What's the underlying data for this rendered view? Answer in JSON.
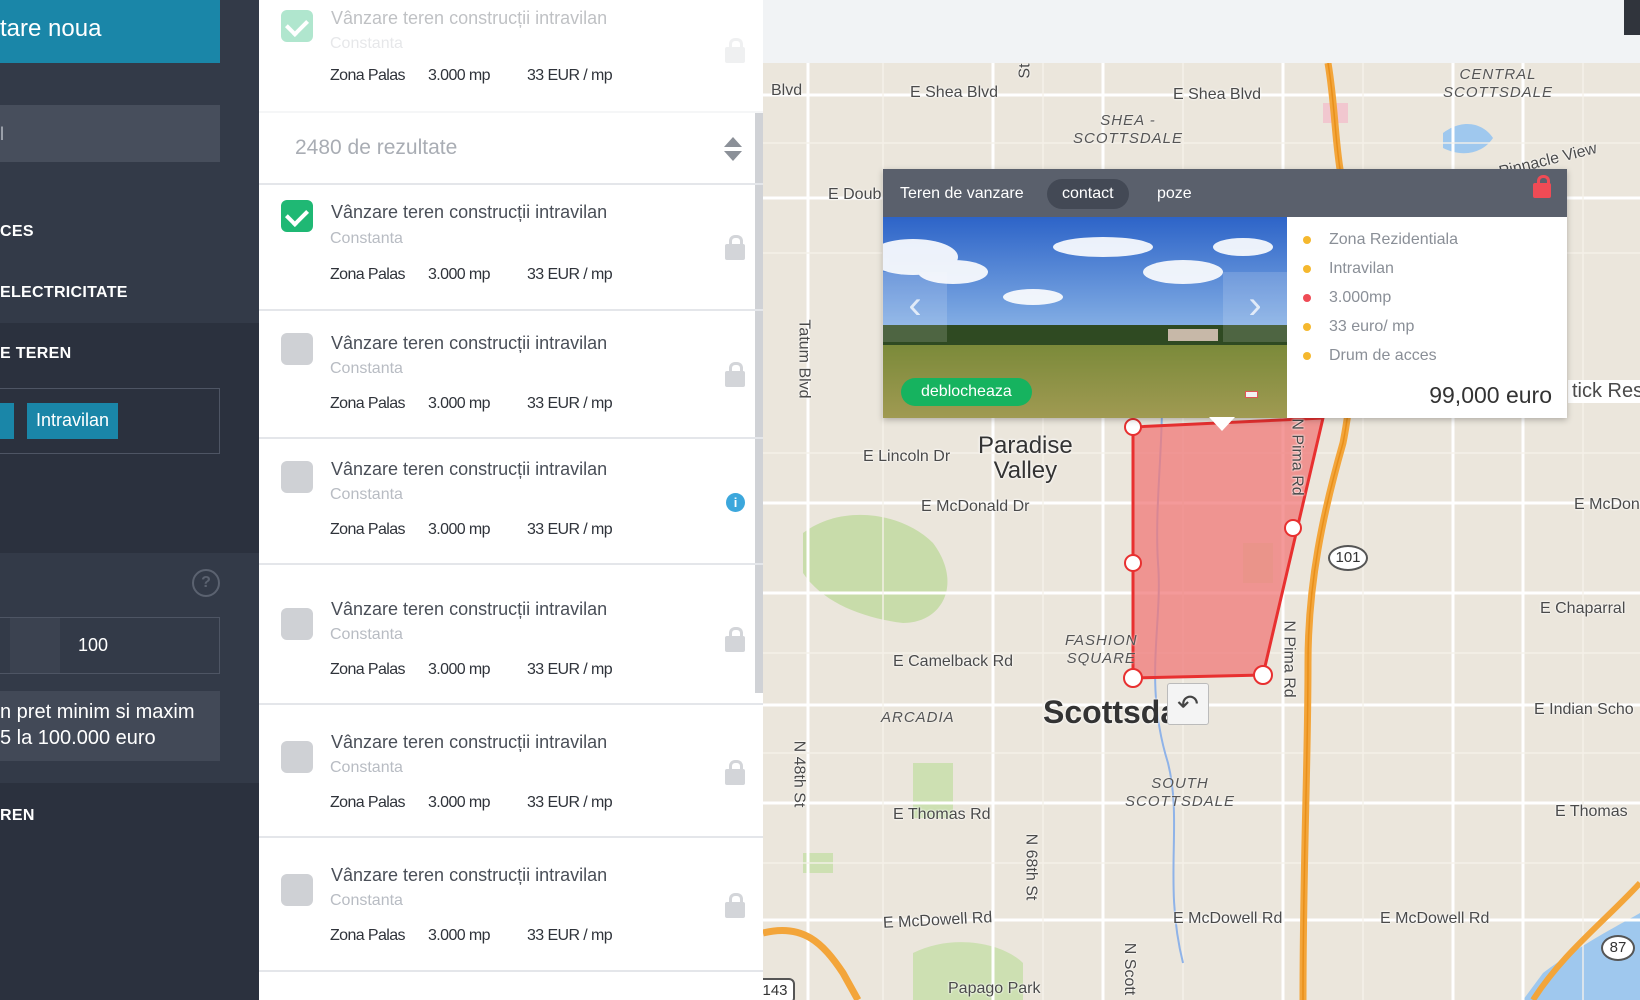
{
  "sidebar": {
    "new_button": "tare noua",
    "search_value": "l",
    "labels": {
      "access": "CES",
      "electricity": "ELECTRICITATE",
      "land_type": "E TEREN",
      "land": "REN"
    },
    "chips": [
      "",
      "Intravilan"
    ],
    "help": "?",
    "range_max": "100",
    "price_note_line1": "n pret minim si maxim",
    "price_note_line2": "5 la 100.000 euro"
  },
  "results": {
    "count": "2480 de rezultate",
    "items": [
      {
        "title": "Vânzare teren construcții intravilan",
        "city": "Constanta",
        "zone": "Zona Palas",
        "area": "3.000 mp",
        "price": "33 EUR / mp",
        "checked": true,
        "icon": "lock-icon"
      },
      {
        "title": "Vânzare teren construcții intravilan",
        "city": "Constanta",
        "zone": "Zona Palas",
        "area": "3.000 mp",
        "price": "33 EUR / mp",
        "checked": true,
        "icon": "lock-icon"
      },
      {
        "title": "Vânzare teren construcții intravilan",
        "city": "Constanta",
        "zone": "Zona Palas",
        "area": "3.000 mp",
        "price": "33 EUR / mp",
        "checked": false,
        "icon": "lock-icon"
      },
      {
        "title": "Vânzare teren construcții intravilan",
        "city": "Constanta",
        "zone": "Zona Palas",
        "area": "3.000 mp",
        "price": "33 EUR / mp",
        "checked": false,
        "icon": "info-icon"
      },
      {
        "title": "Vânzare teren construcții intravilan",
        "city": "Constanta",
        "zone": "Zona Palas",
        "area": "3.000 mp",
        "price": "33 EUR / mp",
        "checked": false,
        "icon": "lock-icon"
      },
      {
        "title": "Vânzare teren construcții intravilan",
        "city": "Constanta",
        "zone": "Zona Palas",
        "area": "3.000 mp",
        "price": "33 EUR / mp",
        "checked": false,
        "icon": "lock-icon"
      },
      {
        "title": "Vânzare teren construcții intravilan",
        "city": "Constanta",
        "zone": "Zona Palas",
        "area": "3.000 mp",
        "price": "33 EUR / mp",
        "checked": false,
        "icon": "lock-icon"
      }
    ]
  },
  "popup": {
    "title": "Teren de vanzare",
    "tabs": [
      "contact",
      "poze"
    ],
    "unlock_button": "deblocheaza",
    "features": [
      {
        "text": "Zona Rezidentiala",
        "color": "#f5b82e"
      },
      {
        "text": "Intravilan",
        "color": "#f5b82e"
      },
      {
        "text": "3.000mp",
        "color": "#ef4b55"
      },
      {
        "text": "33 euro/ mp",
        "color": "#f5b82e"
      },
      {
        "text": "Drum de acces",
        "color": "#f5b82e"
      }
    ],
    "price": "99,000 euro"
  },
  "map": {
    "streets": {
      "e_shea_blvd_1": "E Shea Blvd",
      "e_shea_blvd_2": "E Shea Blvd",
      "blvd": "Blvd",
      "st": "St",
      "e_doub": "E Doub",
      "tatum": "Tatum Blvd",
      "e_lincoln": "E Lincoln Dr",
      "e_mcdonald": "E McDonald Dr",
      "e_mcdon_right": "E McDon",
      "pima_top": "N Pima Rd",
      "pima_mid": "N Pima Rd",
      "e_chaparral": "E Chaparral",
      "e_camelback": "E Camelback Rd",
      "e_indian": "E Indian Scho",
      "n48": "N 48th St",
      "e_thomas_left": "E Thomas Rd",
      "e_thomas_right": "E Thomas",
      "n68": "N 68th St",
      "e_mcdowell_1": "E McDowell Rd",
      "e_mcdowell_2": "E McDowell Rd",
      "e_mcdowell_3": "E McDowell Rd",
      "n_scott": "N Scott",
      "pinnacle": "Pinnacle View",
      "tick_res": "tick Res"
    },
    "districts": {
      "central_scottsdale": "CENTRAL\nSCOTTSDALE",
      "shea_scottsdale": "SHEA -\nSCOTTSDALE",
      "fashion_square": "FASHION\nSQUARE",
      "arcadia": "ARCADIA",
      "south_scottsdale": "SOUTH\nSCOTTSDALE",
      "papago": "Papago Park"
    },
    "cities": {
      "paradise_valley": "Paradise\nValley",
      "scottsdale": "Scottsdale"
    },
    "shields": {
      "r101": "101",
      "r87": "87",
      "r143": "143"
    },
    "undo": "↶"
  }
}
